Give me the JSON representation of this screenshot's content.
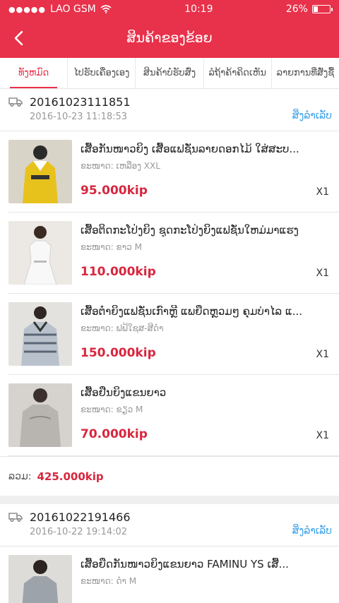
{
  "status_bar": {
    "carrier": "LAO GSM",
    "signal_dots": "●●●●●",
    "time": "10:19",
    "battery": "26%",
    "battery_level": 0.26
  },
  "header": {
    "title": "ສິນຄ້າຂອງຂ້ອຍ"
  },
  "tabs": [
    {
      "label": "ທັງຫມົດ"
    },
    {
      "label": "ໄປຮັບເຄື່ອງເອງ"
    },
    {
      "label": "ສິນຄ້າບໍ່ຮັບສົ່ງ"
    },
    {
      "label": "ລໍຖ້າຄ້າຄິດເຫັນ"
    },
    {
      "label": "ລາຍການທີ່ສັ່ງຊື້"
    }
  ],
  "orders": [
    {
      "id": "20161023111851",
      "date": "2016-10-23 11:18:53",
      "track_label": "ສິ່ງລຳເລັບ",
      "items": [
        {
          "name": "ເສື້ອກັນໜາວຍິງ ເສື້ອແຟຊັ່ນລາຍດອກໄມ້ ໃສ່ສະບ...",
          "attr": "ຂະໜາດ: ເຫລືອງ  XXL",
          "price": "95.000kip",
          "qty": "X1"
        },
        {
          "name": "ເສື້ອຕິດກະໂປ່ງຍິງ ຊຸດກະໂປ່ງຍິງແຟຊັ່ນໃຫມ່ມາແຮງ",
          "attr": "ຂະໜາດ: ຂາວ M",
          "price": "110.000kip",
          "qty": "X1"
        },
        {
          "name": "ເສື້ອຕ໋າຍິງແຟຊັ່ນເກົາຫຼີ ແພຍືດຫຼວມໆ ຄຸມບ່າໄລ ແ...",
          "attr": "ຂະໜາດ: ຟຟ້ໃຊສ-ສີດຳ",
          "price": "150.000kip",
          "qty": "X1"
        },
        {
          "name": "ເສື້ອຢືນຍິງແຂນຍາວ",
          "attr": "ຂະໜາດ: ຂຽວ M",
          "price": "70.000kip",
          "qty": "X1"
        }
      ],
      "total_label": "ລວມ:",
      "total": "425.000kip"
    },
    {
      "id": "20161022191466",
      "date": "2016-10-22 19:14:02",
      "track_label": "ສິ່ງລຳເລັບ",
      "items": [
        {
          "name": "ເສື້ອຍືດກັນໜາວຍິງແຂນຍາວ FAMINU YS ເສື້...",
          "attr": "ຂະໜາດ: ດຳ M",
          "price": "",
          "qty": ""
        }
      ]
    }
  ],
  "colors": {
    "brand": "#e8314a",
    "price": "#d8263e",
    "link": "#3aa0e8"
  }
}
